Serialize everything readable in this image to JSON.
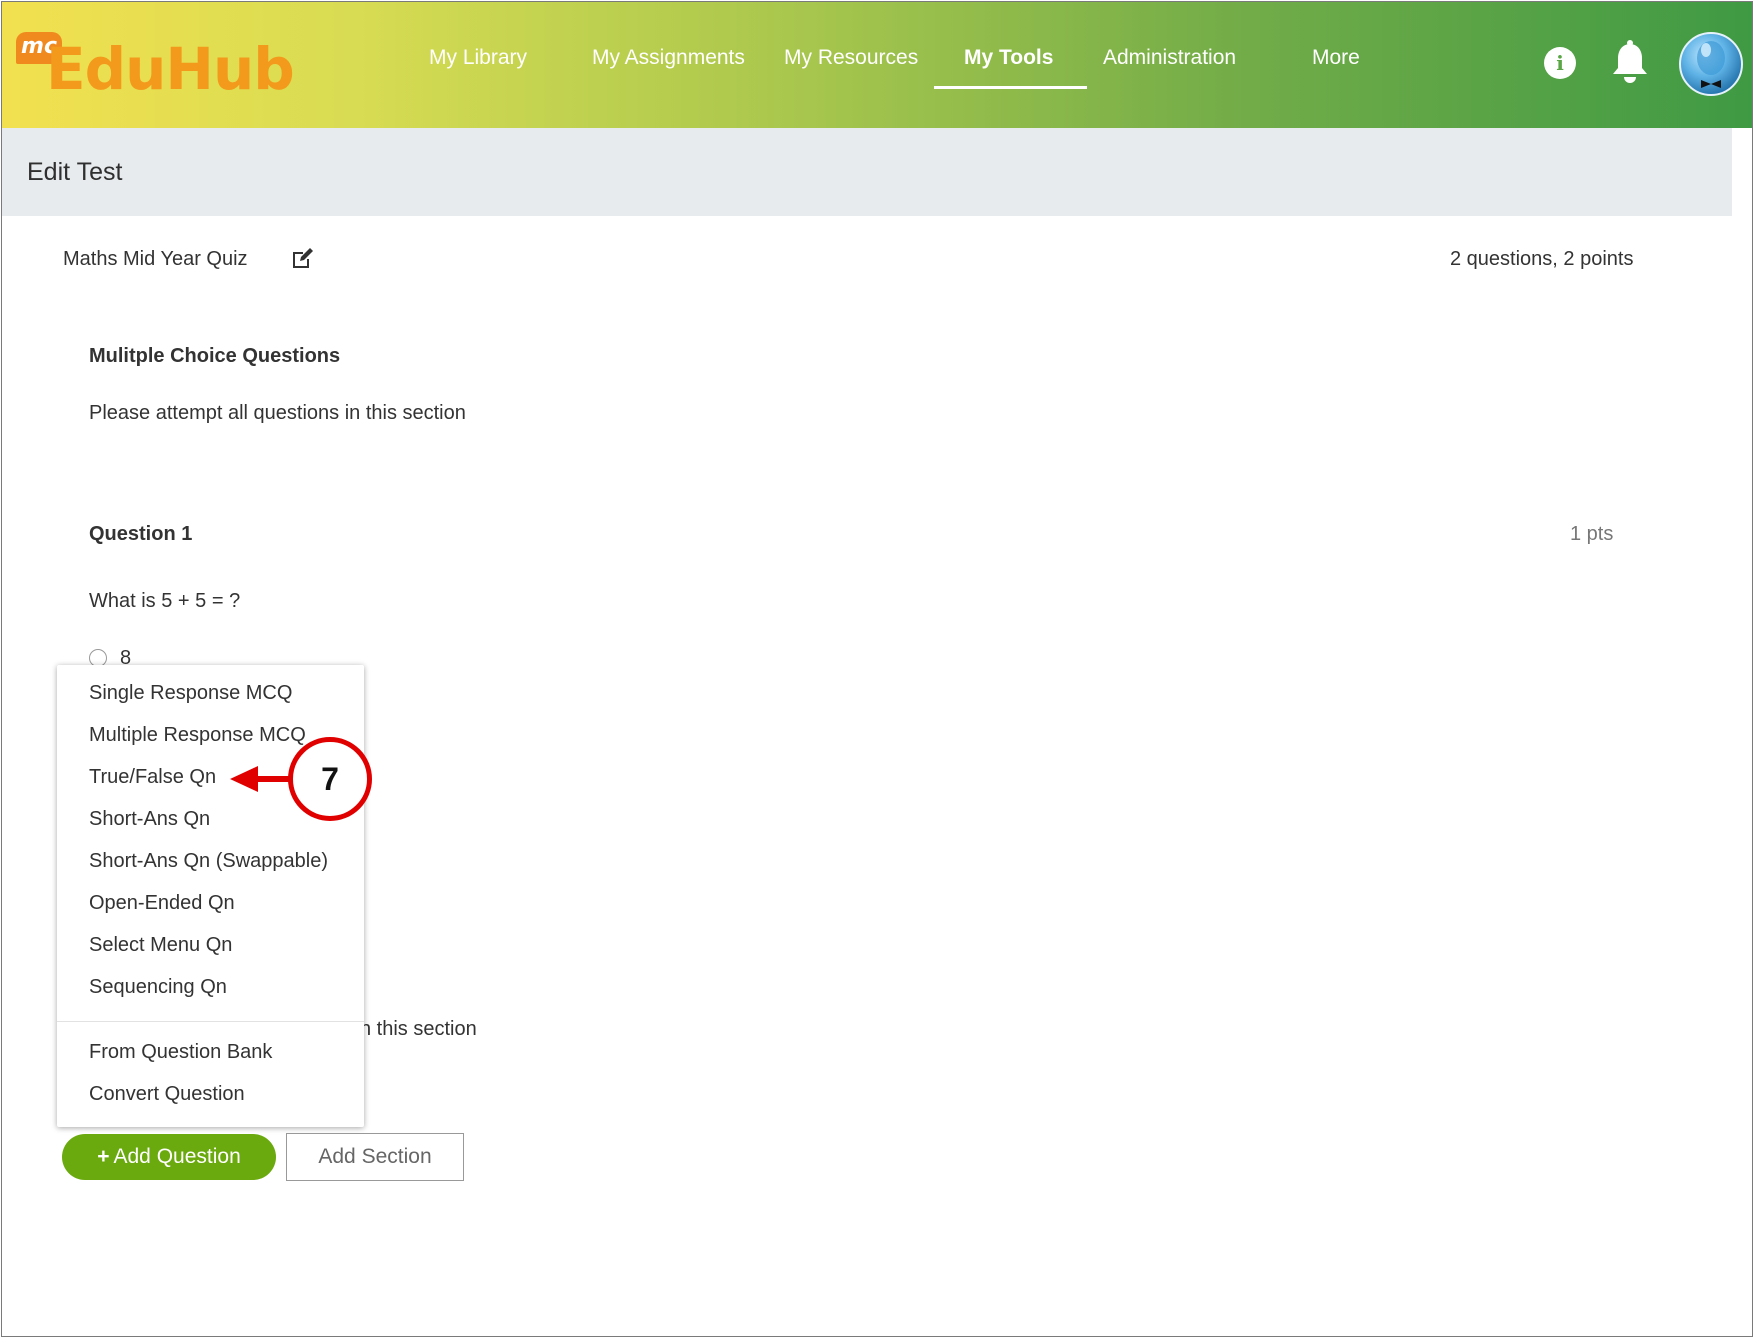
{
  "app": {
    "logo_badge": "mc",
    "logo_text": "EduHub"
  },
  "nav": {
    "items": [
      {
        "label": "My Library"
      },
      {
        "label": "My Assignments"
      },
      {
        "label": "My Resources"
      },
      {
        "label": "My Tools",
        "active": true
      },
      {
        "label": "Administration"
      },
      {
        "label": "More"
      }
    ],
    "icons": [
      "info-icon",
      "bell-icon",
      "avatar"
    ],
    "info_glyph": "i"
  },
  "page": {
    "title": "Edit Test"
  },
  "test": {
    "name": "Maths Mid Year Quiz",
    "summary": "2 questions, 2 points"
  },
  "section": {
    "title": "Mulitple Choice Questions",
    "description": "Please attempt all questions in this section",
    "description_partial": "n this section"
  },
  "question": {
    "label": "Question 1",
    "points": "1 pts",
    "text": "What is 5 + 5 = ?",
    "options": [
      "8"
    ]
  },
  "add_menu": {
    "items": [
      "Single Response MCQ",
      "Multiple Response MCQ",
      "True/False Qn",
      "Short-Ans Qn",
      "Short-Ans Qn (Swappable)",
      "Open-Ended Qn",
      "Select Menu Qn",
      "Sequencing Qn"
    ],
    "extra_items": [
      "From Question Bank",
      "Convert Question"
    ]
  },
  "buttons": {
    "add_question_plus": "+",
    "add_question": "Add Question",
    "add_section": "Add Section"
  },
  "annotation": {
    "step_number": "7",
    "color": "#e10000"
  },
  "colors": {
    "accent_green": "#6aaa0e",
    "header_start": "#f2e04f",
    "header_end": "#3f9a44",
    "logo_orange": "#f39a1c"
  }
}
